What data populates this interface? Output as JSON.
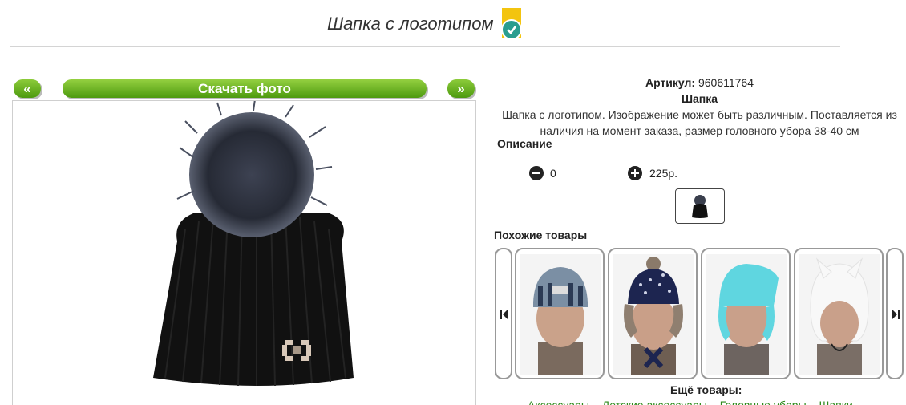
{
  "header": {
    "title": "Шапка с логотипом"
  },
  "viewer": {
    "prev_label": "«",
    "next_label": "»",
    "download_label": "Скачать фото"
  },
  "product": {
    "article_label": "Артикул:",
    "article_value": "960611764",
    "type": "Шапка",
    "description": "Шапка с логотипом. Изображение может быть различным. Поставляется из наличия на момент заказа, размер головного убора 38-40 см",
    "description_label": "Описание",
    "quantity": "0",
    "price": "225р."
  },
  "similar": {
    "label": "Похожие товары"
  },
  "more": {
    "label": "Ещё товары:",
    "links": [
      "Аксессуары",
      "Детские аксессуары",
      "Головные уборы",
      "Шапки"
    ]
  },
  "colors": {
    "accent_green": "#4d9a0f",
    "link_green": "#2d8a1b",
    "badge_yellow": "#f3c40f",
    "badge_teal": "#2a9d8f"
  },
  "icons": {
    "verified": "verified-check-icon",
    "minus": "minus-circle-icon",
    "plus": "plus-circle-icon",
    "carousel_prev": "skip-back-icon",
    "carousel_next": "skip-forward-icon"
  }
}
